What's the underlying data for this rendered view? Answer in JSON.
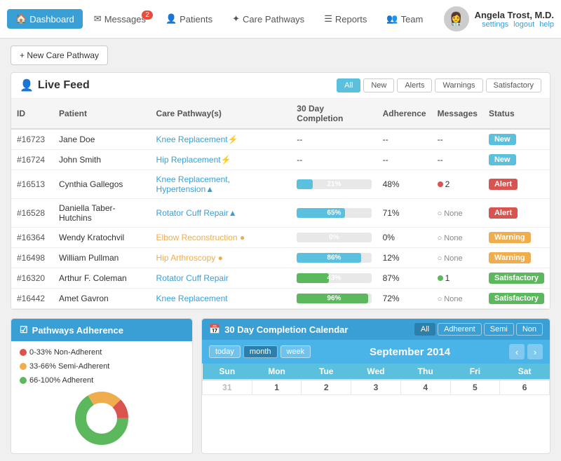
{
  "nav": {
    "items": [
      {
        "id": "dashboard",
        "label": "Dashboard",
        "icon": "🏠",
        "active": true,
        "badge": null
      },
      {
        "id": "messages",
        "label": "Messages",
        "icon": "✉",
        "active": false,
        "badge": "2"
      },
      {
        "id": "patients",
        "label": "Patients",
        "icon": "👤",
        "active": false,
        "badge": null
      },
      {
        "id": "care-pathways",
        "label": "Care Pathways",
        "icon": "✦",
        "active": false,
        "badge": null
      },
      {
        "id": "reports",
        "label": "Reports",
        "icon": "☰",
        "active": false,
        "badge": null
      },
      {
        "id": "team",
        "label": "Team",
        "icon": "👥",
        "active": false,
        "badge": null
      }
    ],
    "user": {
      "name": "Angela Trost, M.D.",
      "settings": "settings",
      "logout": "logout",
      "help": "help"
    }
  },
  "buttons": {
    "new_care_pathway": "+ New Care Pathway"
  },
  "live_feed": {
    "title": "Live Feed",
    "filters": [
      "All",
      "New",
      "Alerts",
      "Warnings",
      "Satisfactory"
    ],
    "active_filter": "All",
    "columns": [
      "ID",
      "Patient",
      "Care Pathway(s)",
      "30 Day Completion",
      "Adherence",
      "Messages",
      "Status"
    ],
    "rows": [
      {
        "id": "#16723",
        "patient": "Jane Doe",
        "pathways": "Knee Replacement⚡",
        "completion": null,
        "adherence": "--",
        "messages": "--",
        "status": "New",
        "status_type": "new",
        "completion_pct": 0
      },
      {
        "id": "#16724",
        "patient": "John Smith",
        "pathways": "Hip Replacement⚡",
        "completion": null,
        "adherence": "--",
        "messages": "--",
        "status": "New",
        "status_type": "new",
        "completion_pct": 0
      },
      {
        "id": "#16513",
        "patient": "Cynthia Gallegos",
        "pathways": "Knee Replacement, Hypertension▲",
        "completion": "21%",
        "adherence": "48%",
        "messages": "2",
        "messages_type": "alert",
        "status": "Alert",
        "status_type": "alert",
        "completion_pct": 21
      },
      {
        "id": "#16528",
        "patient": "Daniella Taber-Hutchins",
        "pathways": "Rotator Cuff Repair▲",
        "completion": "65%",
        "adherence": "71%",
        "messages": "None",
        "messages_type": "none",
        "status": "Alert",
        "status_type": "alert",
        "completion_pct": 65
      },
      {
        "id": "#16364",
        "patient": "Wendy Kratochvil",
        "pathways": "Elbow Reconstruction ●",
        "completion": "0%",
        "adherence": "0%",
        "messages": "None",
        "messages_type": "none",
        "status": "Warning",
        "status_type": "warning",
        "completion_pct": 0
      },
      {
        "id": "#16498",
        "patient": "William Pullman",
        "pathways": "Hip Arthroscopy ●",
        "completion": "86%",
        "adherence": "12%",
        "messages": "None",
        "messages_type": "none",
        "status": "Warning",
        "status_type": "warning",
        "completion_pct": 86
      },
      {
        "id": "#16320",
        "patient": "Arthur F. Coleman",
        "pathways": "Rotator Cuff Repair",
        "completion": "43%",
        "adherence": "87%",
        "messages": "1",
        "messages_type": "satisfactory",
        "status": "Satisfactory",
        "status_type": "satisfactory",
        "completion_pct": 43
      },
      {
        "id": "#16442",
        "patient": "Amet Gavron",
        "pathways": "Knee Replacement",
        "completion": "96%",
        "adherence": "72%",
        "messages": "None",
        "messages_type": "none",
        "status": "Satisfactory",
        "status_type": "satisfactory",
        "completion_pct": 96
      }
    ]
  },
  "pathways_adherence": {
    "title": "Pathways Adherence",
    "legend": [
      {
        "color": "red",
        "label": "0-33% Non-Adherent"
      },
      {
        "color": "orange",
        "label": "33-66% Semi-Adherent"
      },
      {
        "color": "green",
        "label": "66-100% Adherent"
      }
    ]
  },
  "calendar": {
    "title": "30 Day Completion Calendar",
    "filters": [
      "All",
      "Adherent",
      "Semi",
      "Non"
    ],
    "active_filter": "All",
    "period_buttons": [
      "today",
      "month",
      "week"
    ],
    "active_period": "month",
    "month_title": "September 2014",
    "days_of_week": [
      "Sun",
      "Mon",
      "Tue",
      "Wed",
      "Thu",
      "Fri",
      "Sat"
    ],
    "weeks": [
      [
        {
          "day": "31",
          "prev": true
        },
        {
          "day": "1"
        },
        {
          "day": "2"
        },
        {
          "day": "3"
        },
        {
          "day": "4"
        },
        {
          "day": "5"
        },
        {
          "day": "6"
        }
      ]
    ]
  }
}
